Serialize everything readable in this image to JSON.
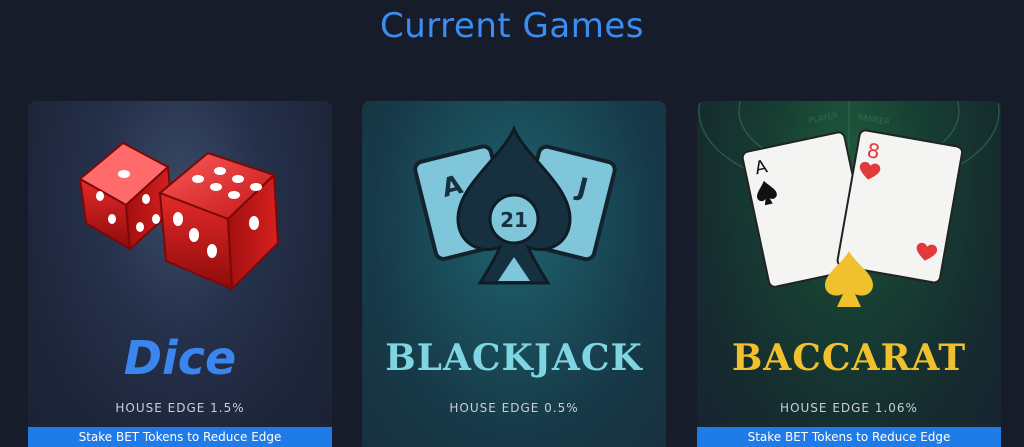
{
  "section": {
    "title": "Current Games"
  },
  "games": [
    {
      "name": "Dice",
      "house_edge": "HOUSE EDGE 1.5%",
      "stake_note": "Stake BET Tokens to Reduce Edge",
      "accent": "#3a86ee",
      "icon": "dice-icon"
    },
    {
      "name": "BLACKJACK",
      "house_edge": "HOUSE EDGE 0.5%",
      "art": {
        "card_left": "A",
        "card_right": "J",
        "badge": "21"
      },
      "accent": "#7fd6e2",
      "icon": "spade-cards-icon"
    },
    {
      "name": "BACCARAT",
      "house_edge": "HOUSE EDGE 1.06%",
      "stake_note": "Stake BET Tokens to Reduce Edge",
      "art": {
        "card_left": "A",
        "card_right": "8",
        "table_left": "PLAYER",
        "table_right": "BANKER"
      },
      "accent": "#f0c12c",
      "icon": "baccarat-cards-icon"
    }
  ],
  "colors": {
    "background": "#161c2a",
    "title": "#3d8cf0",
    "stake_bar": "#1f7be8"
  }
}
